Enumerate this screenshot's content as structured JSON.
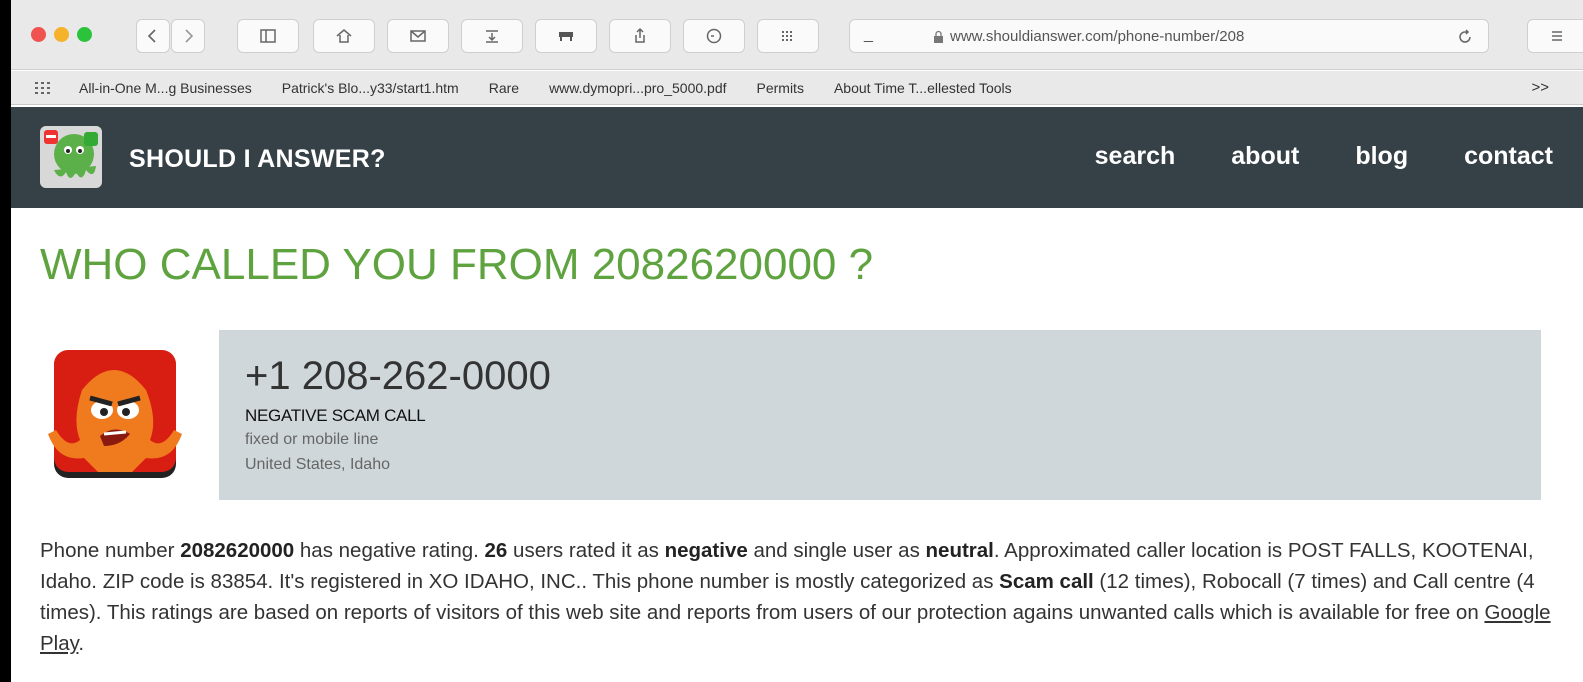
{
  "browser": {
    "url": "www.shouldianswer.com/phone-number/208",
    "bookmarks": [
      "All-in-One M...g Businesses",
      "Patrick's Blo...y33/start1.htm",
      "Rare",
      "www.dymopri...pro_5000.pdf",
      "Permits",
      "About Time T...ellested Tools"
    ],
    "bookmarks_more": ">>"
  },
  "site": {
    "title": "SHOULD I ANSWER?",
    "nav": [
      "search",
      "about",
      "blog",
      "contact"
    ]
  },
  "main": {
    "heading": "WHO CALLED YOU FROM 2082620000 ?",
    "phone_formatted": "+1 208-262-0000",
    "rating_label": "NEGATIVE SCAM CALL",
    "line_type": "fixed or mobile line",
    "location": "United States, Idaho",
    "description": {
      "p1": "Phone number ",
      "number": "2082620000",
      "p2": " has negative rating. ",
      "negative_count": "26",
      "p3": " users rated it as ",
      "negative_word": "negative",
      "p4": " and single user as ",
      "neutral_word": "neutral",
      "p5": ". Approximated caller location is POST FALLS, KOOTENAI, Idaho. ZIP code is 83854. It's registered in XO IDAHO, INC.. This phone number is mostly categorized as ",
      "category": "Scam call",
      "p6": " (12 times), Robocall (7 times) and Call centre (4 times). This ratings are based on reports of visitors of this web site and reports from users of our protection agains unwanted calls which is available for free on ",
      "link": "Google Play",
      "p7": "."
    }
  },
  "colors": {
    "header_bg": "#364047",
    "heading_green": "#5ea33f",
    "info_box_bg": "#cfd7db"
  }
}
